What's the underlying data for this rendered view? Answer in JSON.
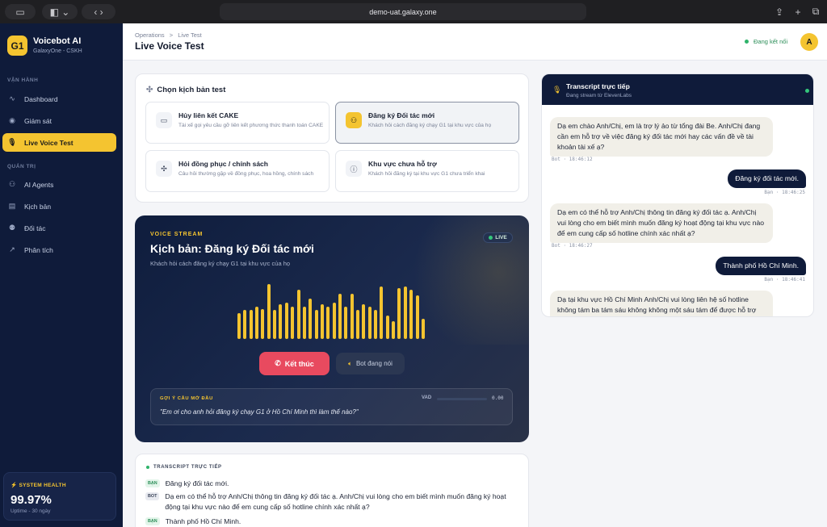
{
  "browser": {
    "url": "demo-uat.galaxy.one"
  },
  "sidebar": {
    "logo_badge": "G1",
    "brand": "Voicebot AI",
    "brand_sub": "GalaxyOne - CSKH",
    "section_operations": "VẬN HÀNH",
    "section_admin": "QUẢN TRỊ",
    "items": [
      {
        "label": "Dashboard",
        "icon": "activity-icon"
      },
      {
        "label": "Giám sát",
        "icon": "radio-icon"
      },
      {
        "label": "Live Voice Test",
        "icon": "mic-icon",
        "active": true
      },
      {
        "label": "AI Agents",
        "icon": "bot-icon"
      },
      {
        "label": "Kịch bản",
        "icon": "document-icon"
      },
      {
        "label": "Đối tác",
        "icon": "users-icon"
      },
      {
        "label": "Phân tích",
        "icon": "trend-icon"
      }
    ],
    "health": {
      "label": "SYSTEM HEALTH",
      "value": "99.97%",
      "sub": "Uptime - 30 ngày"
    }
  },
  "header": {
    "breadcrumb_root": "Operations",
    "breadcrumb_sep": ">",
    "breadcrumb_current": "Live Test",
    "title": "Live Voice Test",
    "status": "Đang kết nối",
    "avatar": "A"
  },
  "scenarios": {
    "title": "Chọn kịch bản test",
    "items": [
      {
        "title": "Hủy liên kết CAKE",
        "desc": "Tài xế gọi yêu cầu gỡ liên kết phương thức thanh toán CAKE",
        "icon": "card-icon",
        "active": false
      },
      {
        "title": "Đăng ký Đối tác mới",
        "desc": "Khách hỏi cách đăng ký chạy G1 tại khu vực của họ",
        "icon": "user-add-icon",
        "active": true
      },
      {
        "title": "Hỏi đồng phục / chính sách",
        "desc": "Câu hỏi thường gặp về đồng phục, hoa hồng, chính sách",
        "icon": "sparkle-icon",
        "active": false
      },
      {
        "title": "Khu vực chưa hỗ trợ",
        "desc": "Khách hỏi đăng ký tại khu vực G1 chưa triển khai",
        "icon": "info-icon",
        "active": false
      }
    ]
  },
  "voice": {
    "label": "VOICE STREAM",
    "title": "Kịch bản: Đăng ký Đối tác mới",
    "subtitle": "Khách hỏi cách đăng ký chạy G1 tại khu vực của họ",
    "live": "LIVE",
    "accent": "#f4c430",
    "end_button": "Kết thúc",
    "bot_status": "Bot đang nói",
    "hint_label": "GỢI Ý CÂU MỞ ĐẦU",
    "hint_text": "\"Em ơi cho anh hỏi đăng ký chạy G1 ở Hồ Chí Minh thì làm thế nào?\"",
    "vad_label": "VAD",
    "vad_value": "0.00",
    "waveform_levels": [
      0.45,
      0.5,
      0.5,
      0.55,
      0.52,
      0.95,
      0.5,
      0.6,
      0.62,
      0.56,
      0.85,
      0.55,
      0.7,
      0.5,
      0.6,
      0.55,
      0.62,
      0.78,
      0.55,
      0.78,
      0.5,
      0.6,
      0.55,
      0.5,
      0.9,
      0.4,
      0.3,
      0.88,
      0.9,
      0.85,
      0.75,
      0.35
    ]
  },
  "live_transcript": {
    "label": "TRANSCRIPT TRỰC TIẾP",
    "rows": [
      {
        "role": "BẠN",
        "text": "Đăng ký đối tác mới."
      },
      {
        "role": "BOT",
        "text": "Dạ em có thể hỗ trợ Anh/Chị thông tin đăng ký đối tác ạ. Anh/Chị vui lòng cho em biết mình muốn đăng ký hoạt động tại khu vực nào để em cung cấp số hotline chính xác nhất ạ?"
      },
      {
        "role": "BẠN",
        "text": "Thành phố Hồ Chí Minh."
      }
    ]
  },
  "transcript": {
    "title": "Transcript trực tiếp",
    "subtitle": "Đang stream từ ElevenLabs",
    "messages": [
      {
        "role": "bot",
        "text": "Dạ em chào Anh/Chị, em là trợ lý ảo từ tổng đài Be. Anh/Chị đang cần em hỗ trợ về việc đăng ký đối tác mới hay các vấn đề về tài khoản tài xế ạ?",
        "meta": "Bot · 18:46:12"
      },
      {
        "role": "user",
        "text": "Đăng ký đối tác mới.",
        "meta": "Bạn · 18:46:25"
      },
      {
        "role": "bot",
        "text": "Dạ em có thể hỗ trợ Anh/Chị thông tin đăng ký đối tác ạ. Anh/Chị vui lòng cho em biết mình muốn đăng ký hoạt động tại khu vực nào để em cung cấp số hotline chính xác nhất ạ?",
        "meta": "Bot · 18:46:27"
      },
      {
        "role": "user",
        "text": "Thành phố Hồ Chí Minh.",
        "meta": "Bạn · 18:46:41"
      },
      {
        "role": "bot",
        "text": "Dạ tại khu vực Hồ Chí Minh Anh/Chị vui lòng liên hệ số hotline không tám ba tám sáu không không một sáu tám để được hỗ trợ đăng ký ạ. Thời gian làm việc của hotline là từ tám giờ sáng"
      }
    ]
  }
}
